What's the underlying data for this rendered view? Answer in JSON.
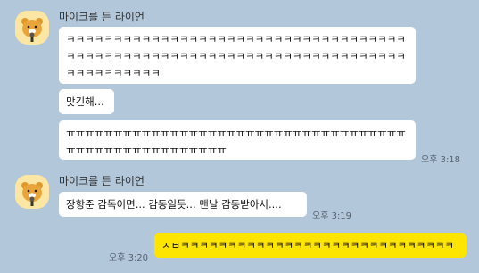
{
  "chat": {
    "group1": {
      "sender": "마이크를 든 라이언",
      "avatar_icon": "ryan-with-microphone-avatar",
      "messages": [
        {
          "text": "ㅋㅋㅋㅋㅋㅋㅋㅋㅋㅋㅋㅋㅋㅋㅋㅋㅋㅋㅋㅋㅋㅋㅋㅋㅋㅋㅋㅋㅋㅋㅋㅋㅋㅋㅋㅋㅋㅋㅋㅋㅋㅋㅋㅋㅋㅋㅋㅋㅋㅋㅋㅋㅋㅋㅋㅋㅋㅋㅋㅋㅋㅋㅋㅋㅋㅋㅋㅋㅋㅋㅋㅋㅋㅋㅋㅋㅋㅋㅋㅋㅋㅋ"
        },
        {
          "text": "맞긴해..."
        },
        {
          "text": "ㅠㅠㅠㅠㅠㅠㅠㅠㅠㅠㅠㅠㅠㅠㅠㅠㅠㅠㅠㅠㅠㅠㅠㅠㅠㅠㅠㅠㅠㅠㅠㅠㅠㅠㅠㅠㅠㅠㅠㅠㅠㅠㅠㅠㅠㅠㅠㅠㅠㅠㅠㅠㅠ",
          "time": "오후 3:18"
        }
      ]
    },
    "group2": {
      "sender": "마이크를 든 라이언",
      "avatar_icon": "ryan-with-microphone-avatar",
      "messages": [
        {
          "text": "장항준 감독이면... 감동일듯... 맨날 감동받아서....",
          "time": "오후 3:19"
        }
      ]
    },
    "mine": {
      "messages": [
        {
          "text": "ㅅㅂㅋㅋㅋㅋㅋㅋㅋㅋㅋㅋㅋㅋㅋㅋㅋㅋㅋㅋㅋㅋㅋㅋㅋㅋㅋㅋㅋㅋㅋ",
          "time": "오후 3:20"
        }
      ]
    },
    "colors": {
      "background": "#b2c7da",
      "incoming_bubble": "#ffffff",
      "outgoing_bubble": "#fee500"
    }
  }
}
